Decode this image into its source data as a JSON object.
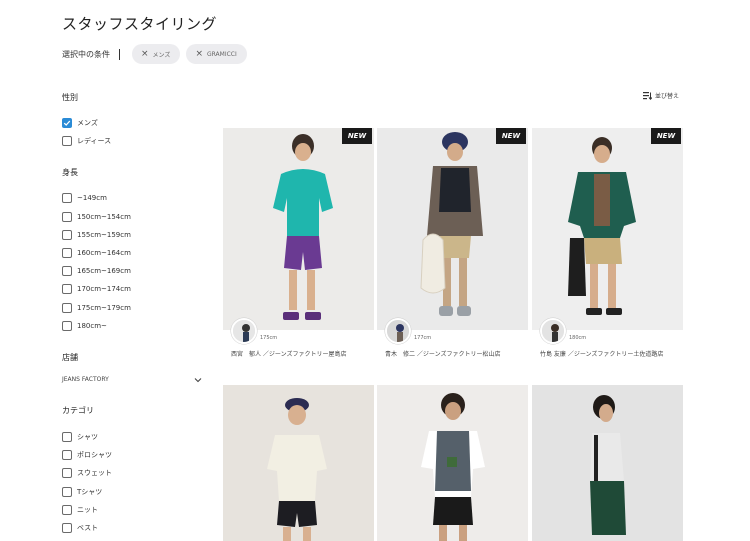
{
  "page_title": "スタッフスタイリング",
  "conditions": {
    "label": "選択中の条件",
    "chips": [
      "メンズ",
      "GRAMICCI"
    ]
  },
  "sort_label": "並び替え",
  "sidebar": {
    "gender": {
      "title": "性別",
      "options": [
        {
          "label": "メンズ",
          "checked": true
        },
        {
          "label": "レディース",
          "checked": false
        }
      ]
    },
    "height": {
      "title": "身長",
      "options": [
        {
          "label": "~149cm",
          "checked": false
        },
        {
          "label": "150cm~154cm",
          "checked": false
        },
        {
          "label": "155cm~159cm",
          "checked": false
        },
        {
          "label": "160cm~164cm",
          "checked": false
        },
        {
          "label": "165cm~169cm",
          "checked": false
        },
        {
          "label": "170cm~174cm",
          "checked": false
        },
        {
          "label": "175cm~179cm",
          "checked": false
        },
        {
          "label": "180cm~",
          "checked": false
        }
      ]
    },
    "store": {
      "title": "店舗",
      "selected": "JEANS FACTORY"
    },
    "category": {
      "title": "カテゴリ",
      "options": [
        {
          "label": "シャツ",
          "checked": false
        },
        {
          "label": "ポロシャツ",
          "checked": false
        },
        {
          "label": "スウェット",
          "checked": false
        },
        {
          "label": "Tシャツ",
          "checked": false
        },
        {
          "label": "ニット",
          "checked": false
        },
        {
          "label": "ベスト",
          "checked": false
        }
      ]
    }
  },
  "cards": [
    {
      "badge": "NEW",
      "height": "175cm",
      "name": "西宮　郁人 ／ジーンズファクトリー屋島店",
      "bg": "#ecebe9"
    },
    {
      "badge": "NEW",
      "height": "177cm",
      "name": "青木　修二 ／ジーンズファクトリー松山店",
      "bg": "#eaeaea"
    },
    {
      "badge": "NEW",
      "height": "180cm",
      "name": "竹島 友廉 ／ジーンズファクトリー土佐道路店",
      "bg": "#eeeeee"
    },
    {
      "badge": "",
      "height": "",
      "name": "",
      "bg": "#e7e3dd"
    },
    {
      "badge": "",
      "height": "",
      "name": "",
      "bg": "#eeecea"
    },
    {
      "badge": "",
      "height": "",
      "name": "",
      "bg": "#e3e3e3"
    }
  ]
}
